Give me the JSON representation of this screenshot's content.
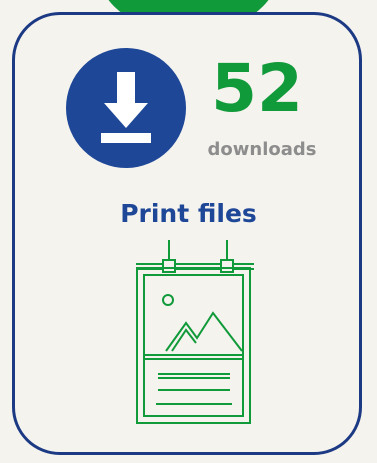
{
  "colors": {
    "accent_green": "#119a3a",
    "brand_blue": "#1e4798",
    "card_border": "#1c3a84",
    "muted_text": "#8d8d8d",
    "background": "#f5f3ee"
  },
  "icons": {
    "badge": "download-icon",
    "illustration": "print-poster-icon"
  },
  "stats": {
    "count": "52",
    "label": "downloads"
  },
  "section": {
    "title": "Print files"
  }
}
